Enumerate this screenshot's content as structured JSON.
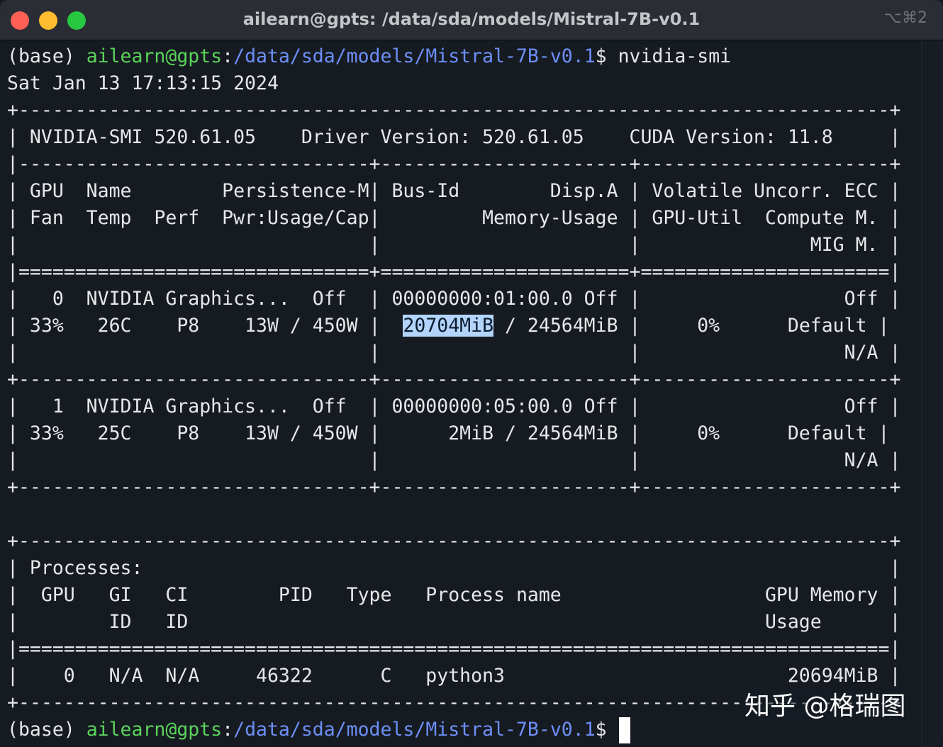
{
  "window": {
    "title": "ailearn@gpts: /data/sda/models/Mistral-7B-v0.1",
    "shortcut": "⌥⌘2"
  },
  "prompt": {
    "env": "(base) ",
    "user_host": "ailearn@gpts",
    "colon": ":",
    "path": "/data/sda/models/Mistral-7B-v0.1",
    "dollar": "$ ",
    "command": "nvidia-smi"
  },
  "terminal": {
    "date_line": "Sat Jan 13 17:13:15 2024",
    "header": [
      "+-----------------------------------------------------------------------------+",
      "| NVIDIA-SMI 520.61.05    Driver Version: 520.61.05    CUDA Version: 11.8     |",
      "|-------------------------------+----------------------+----------------------+",
      "| GPU  Name        Persistence-M| Bus-Id        Disp.A | Volatile Uncorr. ECC |",
      "| Fan  Temp  Perf  Pwr:Usage/Cap|         Memory-Usage | GPU-Util  Compute M. |",
      "|                               |                      |               MIG M. |",
      "|===============================+======================+======================|",
      "|   0  NVIDIA Graphics...  Off  | 00000000:01:00.0 Off |                  Off |"
    ],
    "gpu0_row2_pre": "| 33%   26C    P8    13W / 450W |  ",
    "gpu0_mem_used": "20704MiB",
    "gpu0_row2_post": " / 24564MiB |     0%      Default |",
    "body": [
      "|                               |                      |                  N/A |",
      "+-------------------------------+----------------------+----------------------+",
      "|   1  NVIDIA Graphics...  Off  | 00000000:05:00.0 Off |                  Off |",
      "| 33%   25C    P8    13W / 450W |      2MiB / 24564MiB |     0%      Default |",
      "|                               |                      |                  N/A |",
      "+-------------------------------+----------------------+----------------------+",
      "",
      "+-----------------------------------------------------------------------------+",
      "| Processes:                                                                  |",
      "|  GPU   GI   CI        PID   Type   Process name                  GPU Memory |",
      "|        ID   ID                                                   Usage      |",
      "|=============================================================================|",
      "|    0   N/A  N/A     46322      C   python3                         20694MiB |",
      "+-----------------------------------------------------------------------------+"
    ]
  },
  "watermark": "知乎 @格瑞图"
}
